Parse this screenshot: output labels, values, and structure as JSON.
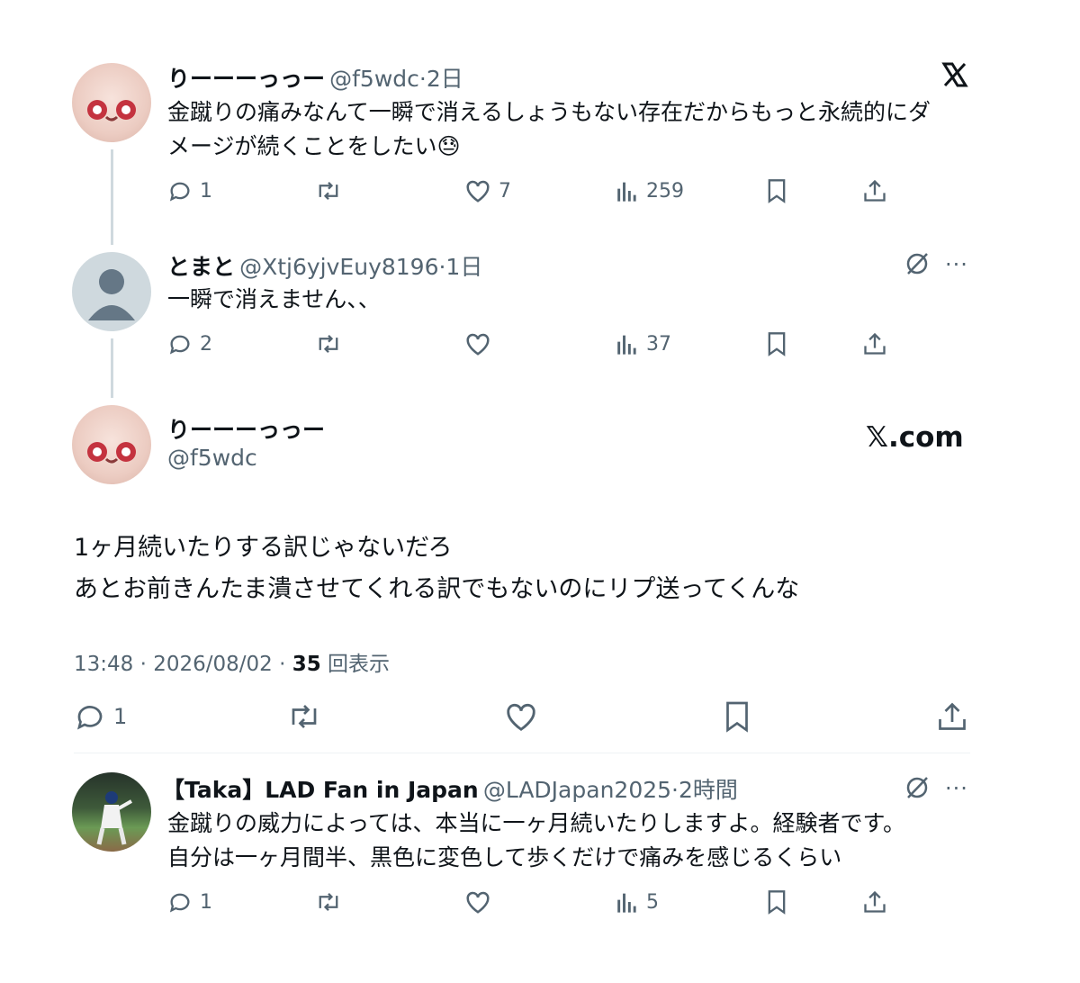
{
  "tweet1": {
    "name": "りーーーっっー",
    "handle": "@f5wdc",
    "time": "·2日",
    "text_line1": "金蹴りの痛みなんて一瞬で消えるしょうもない存在だからもっと永続的にダ",
    "text_line2": "メージが続くことをしたい😓",
    "replies": "1",
    "likes": "7",
    "views": "259",
    "icon": "x-logo-icon"
  },
  "tweet2": {
    "name": "とまと",
    "handle": "@Xtj6yjvEuy8196",
    "time": "·1日",
    "text": "一瞬で消えません、、",
    "replies": "2",
    "views": "37"
  },
  "main_tweet": {
    "name": "りーーーっっー",
    "handle": "@f5wdc",
    "brand": "𝕏.com",
    "text_line1": "1ヶ月続いたりする訳じゃないだろ",
    "text_line2": "あとお前きんたま潰させてくれる訳でもないのにリプ送ってくんな",
    "timestamp": "13:48 · 2026/08/02 · ",
    "views_count": "35",
    "views_label": " 回表示",
    "replies": "1"
  },
  "tweet3": {
    "name": "【Taka】LAD Fan in Japan",
    "handle": "@LADJapan2025",
    "time": "·2時間",
    "text_line1": "金蹴りの威力によっては、本当に一ヶ月続いたりしますよ。経験者です。",
    "text_line2": "自分は一ヶ月間半、黒色に変色して歩くだけで痛みを感じるくらい",
    "replies": "1",
    "views": "5"
  },
  "colors": {
    "text": "#0f1419",
    "secondary": "#536471",
    "line": "#cfd9de"
  }
}
